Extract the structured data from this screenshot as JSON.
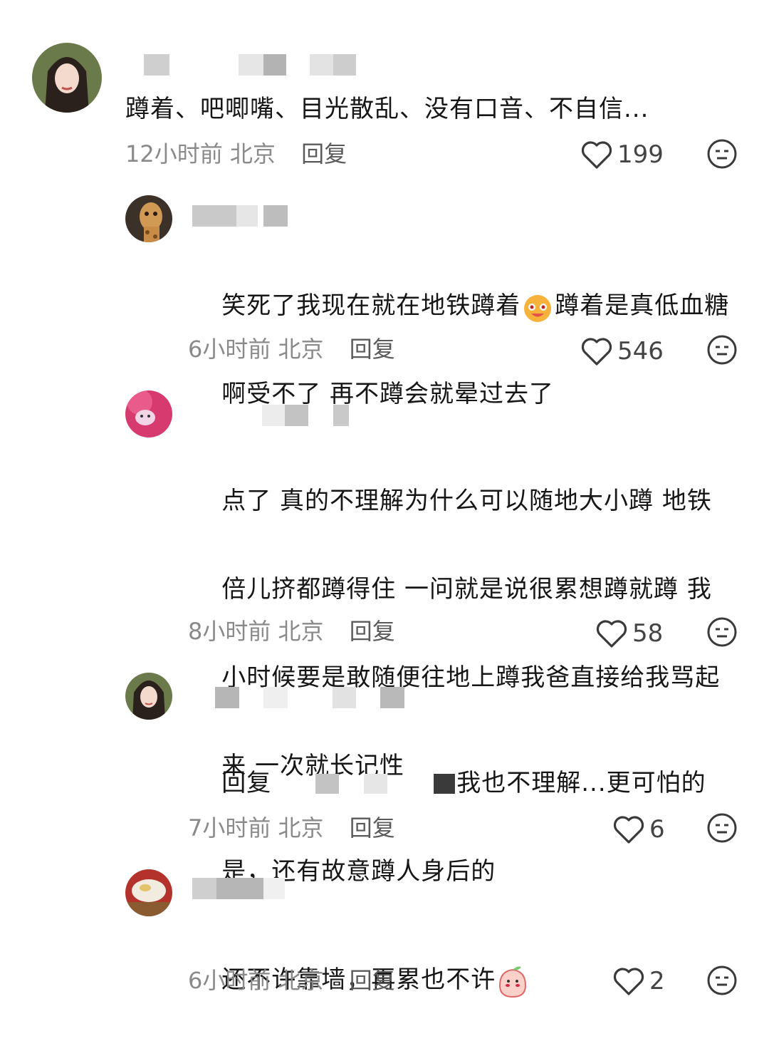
{
  "comments": [
    {
      "text": "蹲着、吧唧嘴、目光散乱、没有口音、不自信...",
      "time": "12小时前",
      "location": "北京",
      "reply_label": "回复",
      "likes": "199"
    },
    {
      "text_line1_a": "笑死了我现在就在地铁蹲着",
      "text_line1_b": "蹲着是真低血糖",
      "text_line2": "啊受不了 再不蹲会就晕过去了",
      "time": "6小时前",
      "location": "北京",
      "reply_label": "回复",
      "likes": "546"
    },
    {
      "lines": [
        "点了 真的不理解为什么可以随地大小蹲 地铁",
        "倍儿挤都蹲得住 一问就是说很累想蹲就蹲 我",
        "小时候要是敢随便往地上蹲我爸直接给我骂起",
        "来 一次就长记性"
      ],
      "time": "8小时前",
      "location": "北京",
      "reply_label": "回复",
      "likes": "58"
    },
    {
      "reply_prefix": "回复",
      "text_line1": "我也不理解...更可怕的",
      "text_line2": "是，还有故意蹲人身后的",
      "time": "7小时前",
      "location": "北京",
      "reply_label": "回复",
      "likes": "6"
    },
    {
      "text": "还不许靠墙，再累也不许",
      "time": "6小时前",
      "location": "北京",
      "reply_label": "回复",
      "likes": "2"
    }
  ],
  "icons": {
    "like": "heart-outline-icon",
    "dislike": "neutral-face-icon"
  }
}
